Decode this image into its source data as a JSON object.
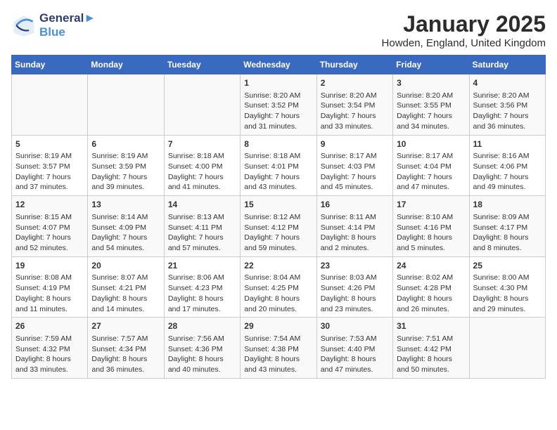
{
  "header": {
    "logo_line1": "General",
    "logo_line2": "Blue",
    "month_title": "January 2025",
    "location": "Howden, England, United Kingdom"
  },
  "weekdays": [
    "Sunday",
    "Monday",
    "Tuesday",
    "Wednesday",
    "Thursday",
    "Friday",
    "Saturday"
  ],
  "weeks": [
    [
      {
        "day": "",
        "info": ""
      },
      {
        "day": "",
        "info": ""
      },
      {
        "day": "",
        "info": ""
      },
      {
        "day": "1",
        "info": "Sunrise: 8:20 AM\nSunset: 3:52 PM\nDaylight: 7 hours\nand 31 minutes."
      },
      {
        "day": "2",
        "info": "Sunrise: 8:20 AM\nSunset: 3:54 PM\nDaylight: 7 hours\nand 33 minutes."
      },
      {
        "day": "3",
        "info": "Sunrise: 8:20 AM\nSunset: 3:55 PM\nDaylight: 7 hours\nand 34 minutes."
      },
      {
        "day": "4",
        "info": "Sunrise: 8:20 AM\nSunset: 3:56 PM\nDaylight: 7 hours\nand 36 minutes."
      }
    ],
    [
      {
        "day": "5",
        "info": "Sunrise: 8:19 AM\nSunset: 3:57 PM\nDaylight: 7 hours\nand 37 minutes."
      },
      {
        "day": "6",
        "info": "Sunrise: 8:19 AM\nSunset: 3:59 PM\nDaylight: 7 hours\nand 39 minutes."
      },
      {
        "day": "7",
        "info": "Sunrise: 8:18 AM\nSunset: 4:00 PM\nDaylight: 7 hours\nand 41 minutes."
      },
      {
        "day": "8",
        "info": "Sunrise: 8:18 AM\nSunset: 4:01 PM\nDaylight: 7 hours\nand 43 minutes."
      },
      {
        "day": "9",
        "info": "Sunrise: 8:17 AM\nSunset: 4:03 PM\nDaylight: 7 hours\nand 45 minutes."
      },
      {
        "day": "10",
        "info": "Sunrise: 8:17 AM\nSunset: 4:04 PM\nDaylight: 7 hours\nand 47 minutes."
      },
      {
        "day": "11",
        "info": "Sunrise: 8:16 AM\nSunset: 4:06 PM\nDaylight: 7 hours\nand 49 minutes."
      }
    ],
    [
      {
        "day": "12",
        "info": "Sunrise: 8:15 AM\nSunset: 4:07 PM\nDaylight: 7 hours\nand 52 minutes."
      },
      {
        "day": "13",
        "info": "Sunrise: 8:14 AM\nSunset: 4:09 PM\nDaylight: 7 hours\nand 54 minutes."
      },
      {
        "day": "14",
        "info": "Sunrise: 8:13 AM\nSunset: 4:11 PM\nDaylight: 7 hours\nand 57 minutes."
      },
      {
        "day": "15",
        "info": "Sunrise: 8:12 AM\nSunset: 4:12 PM\nDaylight: 7 hours\nand 59 minutes."
      },
      {
        "day": "16",
        "info": "Sunrise: 8:11 AM\nSunset: 4:14 PM\nDaylight: 8 hours\nand 2 minutes."
      },
      {
        "day": "17",
        "info": "Sunrise: 8:10 AM\nSunset: 4:16 PM\nDaylight: 8 hours\nand 5 minutes."
      },
      {
        "day": "18",
        "info": "Sunrise: 8:09 AM\nSunset: 4:17 PM\nDaylight: 8 hours\nand 8 minutes."
      }
    ],
    [
      {
        "day": "19",
        "info": "Sunrise: 8:08 AM\nSunset: 4:19 PM\nDaylight: 8 hours\nand 11 minutes."
      },
      {
        "day": "20",
        "info": "Sunrise: 8:07 AM\nSunset: 4:21 PM\nDaylight: 8 hours\nand 14 minutes."
      },
      {
        "day": "21",
        "info": "Sunrise: 8:06 AM\nSunset: 4:23 PM\nDaylight: 8 hours\nand 17 minutes."
      },
      {
        "day": "22",
        "info": "Sunrise: 8:04 AM\nSunset: 4:25 PM\nDaylight: 8 hours\nand 20 minutes."
      },
      {
        "day": "23",
        "info": "Sunrise: 8:03 AM\nSunset: 4:26 PM\nDaylight: 8 hours\nand 23 minutes."
      },
      {
        "day": "24",
        "info": "Sunrise: 8:02 AM\nSunset: 4:28 PM\nDaylight: 8 hours\nand 26 minutes."
      },
      {
        "day": "25",
        "info": "Sunrise: 8:00 AM\nSunset: 4:30 PM\nDaylight: 8 hours\nand 29 minutes."
      }
    ],
    [
      {
        "day": "26",
        "info": "Sunrise: 7:59 AM\nSunset: 4:32 PM\nDaylight: 8 hours\nand 33 minutes."
      },
      {
        "day": "27",
        "info": "Sunrise: 7:57 AM\nSunset: 4:34 PM\nDaylight: 8 hours\nand 36 minutes."
      },
      {
        "day": "28",
        "info": "Sunrise: 7:56 AM\nSunset: 4:36 PM\nDaylight: 8 hours\nand 40 minutes."
      },
      {
        "day": "29",
        "info": "Sunrise: 7:54 AM\nSunset: 4:38 PM\nDaylight: 8 hours\nand 43 minutes."
      },
      {
        "day": "30",
        "info": "Sunrise: 7:53 AM\nSunset: 4:40 PM\nDaylight: 8 hours\nand 47 minutes."
      },
      {
        "day": "31",
        "info": "Sunrise: 7:51 AM\nSunset: 4:42 PM\nDaylight: 8 hours\nand 50 minutes."
      },
      {
        "day": "",
        "info": ""
      }
    ]
  ]
}
